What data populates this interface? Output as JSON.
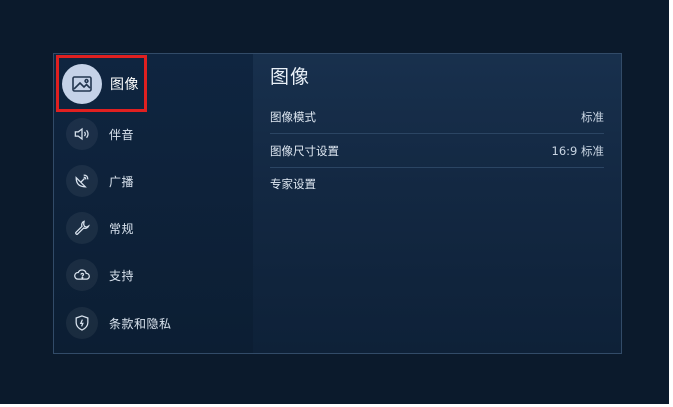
{
  "sidebar": {
    "items": [
      {
        "label": "图像",
        "icon": "picture-icon",
        "active": true
      },
      {
        "label": "伴音",
        "icon": "speaker-icon"
      },
      {
        "label": "广播",
        "icon": "satellite-dish-icon"
      },
      {
        "label": "常规",
        "icon": "wrench-icon"
      },
      {
        "label": "支持",
        "icon": "cloud-help-icon"
      },
      {
        "label": "条款和隐私",
        "icon": "shield-icon"
      }
    ]
  },
  "main": {
    "title": "图像",
    "rows": [
      {
        "label": "图像模式",
        "value": "标准"
      },
      {
        "label": "图像尺寸设置",
        "value": "16:9 标准"
      },
      {
        "label": "专家设置",
        "value": ""
      }
    ]
  },
  "colors": {
    "highlight": "#e02020",
    "active_icon_bg": "#c5d2e8",
    "background": "#0b1a2c"
  }
}
